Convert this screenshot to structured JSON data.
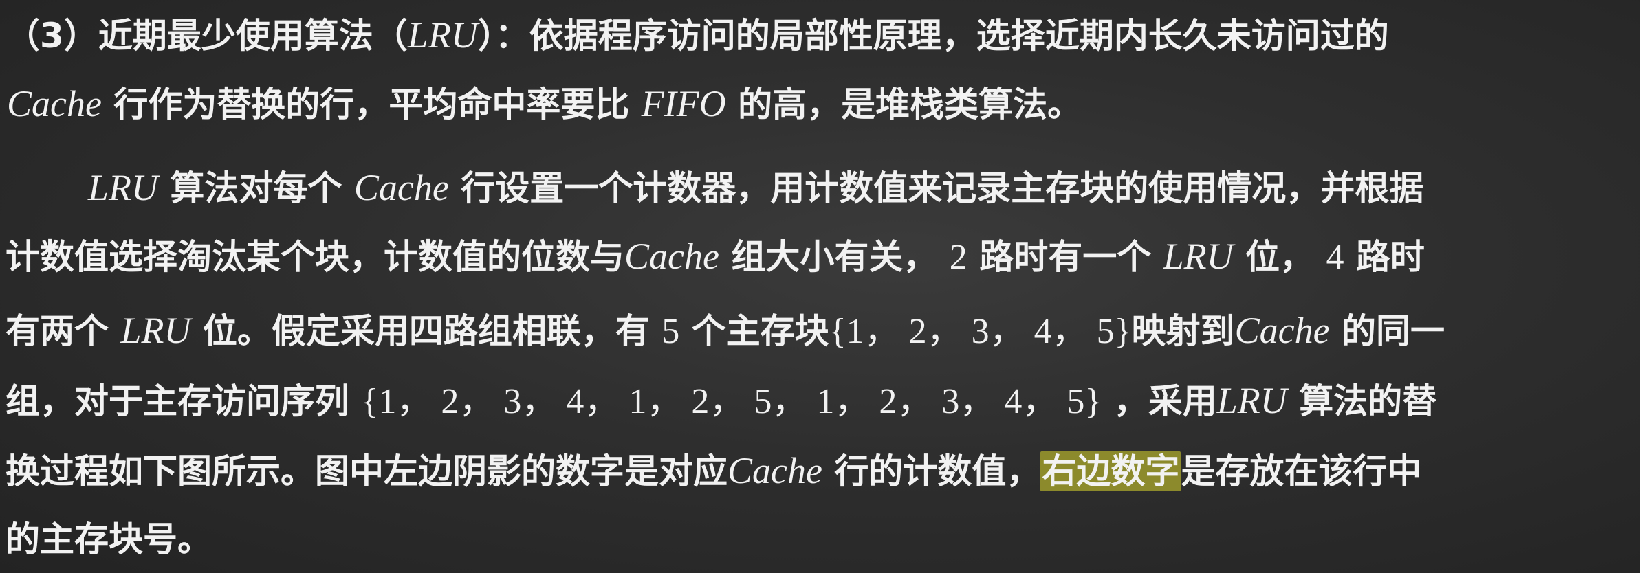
{
  "p1": {
    "prefix": "（3）近期最少使用算法（",
    "lru": "LRU",
    "after_lru": "）：依据程序访问的局部性原理，选择近期内长久未访问过的",
    "cache": "Cache",
    "mid": " 行作为替换的行，平均命中率要比 ",
    "fifo": "FIFO",
    "suffix": " 的高，是堆栈类算法。"
  },
  "p2": {
    "l1_lru": "LRU",
    "l1_a": " 算法对每个 ",
    "l1_cache": "Cache",
    "l1_b": " 行设置一个计数器，用计数值来记录主存块的使用情况，并根据",
    "l2_a": "计数值选择淘汰某个块，计数值的位数与",
    "l2_cache": "Cache",
    "l2_b": " 组大小有关， ",
    "l2_n2": "2",
    "l2_c": " 路时有一个 ",
    "l2_lru": "LRU",
    "l2_d": " 位， ",
    "l2_n4": "4",
    "l2_e": " 路时",
    "l3_a": "有两个 ",
    "l3_lru": "LRU",
    "l3_b": " 位。假定采用四路组相联，有 ",
    "l3_n5": "5",
    "l3_c": " 个主存块",
    "l3_set": "{1， 2， 3， 4， 5}",
    "l3_d": "映射到",
    "l3_cache": "Cache",
    "l3_e": " 的同一",
    "l4_a": "组，对于主存访问序列 ",
    "l4_seq": "{1， 2， 3， 4， 1， 2， 5， 1， 2， 3， 4， 5}",
    "l4_b": " ，采用",
    "l4_lru": "LRU",
    "l4_c": " 算法的替",
    "l5_a": "换过程如下图所示。图中左边阴影的数字是对应",
    "l5_cache": "Cache",
    "l5_b": " 行的计数值，",
    "l5_hl": "右边数字",
    "l5_c": "是存放在该行中",
    "l6": "的主存块号。"
  },
  "colors": {
    "background": "#2e2e2e",
    "text": "#f2f2f2",
    "highlight": "#8c8a2c"
  }
}
